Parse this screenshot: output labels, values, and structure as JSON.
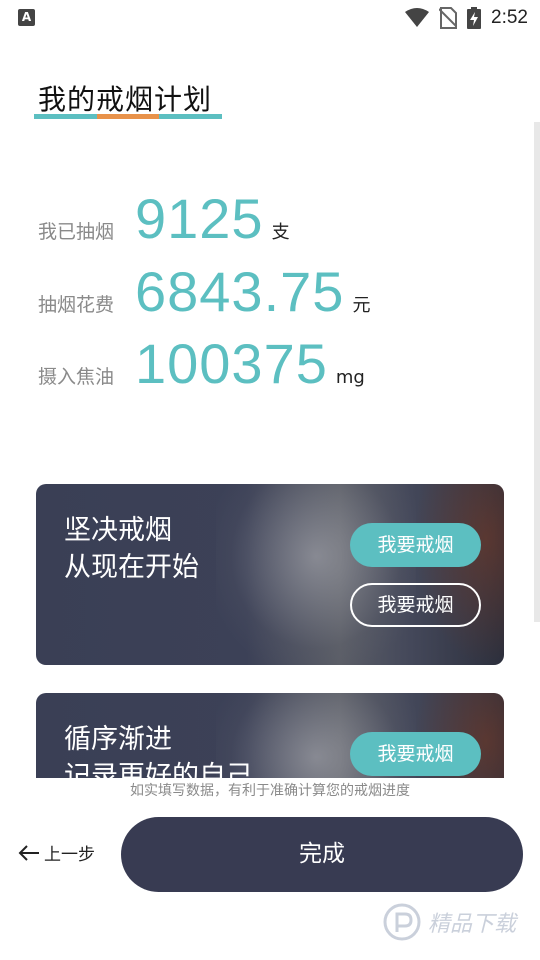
{
  "status_bar": {
    "time": "2:52",
    "notification_icon": "A"
  },
  "header": {
    "title": "我的戒烟计划"
  },
  "colors": {
    "accent": "#5cbfc1",
    "orange": "#e8924a",
    "dark_button": "#383b52"
  },
  "stats": [
    {
      "label": "我已抽烟",
      "value": "9125",
      "unit": "支"
    },
    {
      "label": "抽烟花费",
      "value": "6843.75",
      "unit": "元"
    },
    {
      "label": "摄入焦油",
      "value": "100375",
      "unit": "mg"
    }
  ],
  "cards": [
    {
      "line1": "坚决戒烟",
      "line2": "从现在开始",
      "button1": "我要戒烟",
      "button2": "我要戒烟"
    },
    {
      "line1": "循序渐进",
      "line2": "记录更好的自己",
      "button1": "我要戒烟"
    }
  ],
  "footer": {
    "hint": "如实填写数据，有利于准确计算您的戒烟进度",
    "back_label": "上一步",
    "done_label": "完成"
  },
  "watermark": {
    "text": "精品下载"
  }
}
